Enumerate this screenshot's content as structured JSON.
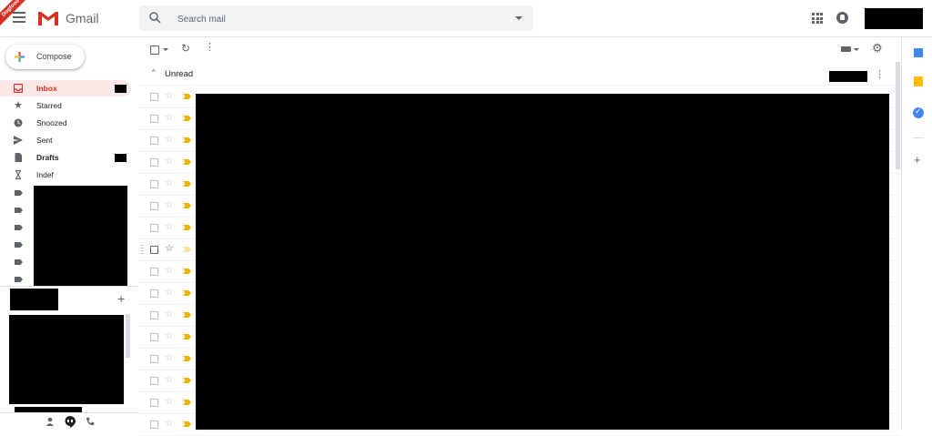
{
  "header": {
    "dogfood_label": "Dogfood",
    "app_name": "Gmail",
    "search_placeholder": "Search mail"
  },
  "sidebar": {
    "compose_label": "Compose",
    "items": [
      {
        "label": "Inbox",
        "icon": "inbox-icon"
      },
      {
        "label": "Starred",
        "icon": "star-icon"
      },
      {
        "label": "Snoozed",
        "icon": "clock-icon"
      },
      {
        "label": "Sent",
        "icon": "send-icon"
      },
      {
        "label": "Drafts",
        "icon": "draft-icon"
      },
      {
        "label": "Indef",
        "icon": "hourglass-icon"
      }
    ]
  },
  "main": {
    "section_title": "Unread",
    "row_count": 16
  },
  "colors": {
    "accent_red": "#d93025",
    "important_yellow": "#f4b400"
  }
}
